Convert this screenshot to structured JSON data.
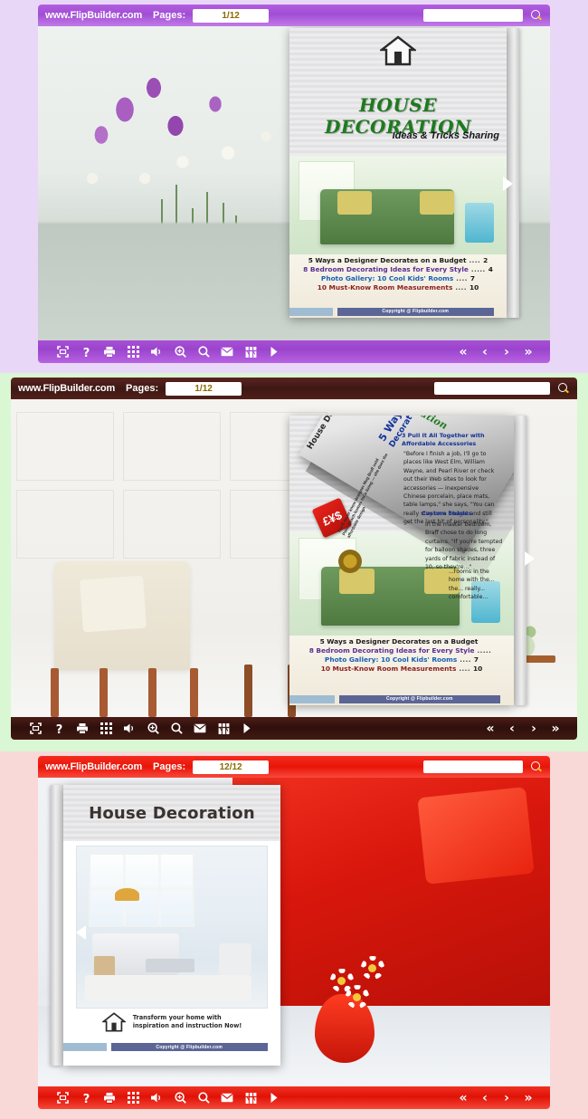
{
  "panels": [
    {
      "id": "panel-1",
      "theme_color": "#a84fd6",
      "background_color": "#e9d7f7",
      "topbar": {
        "brand": "www.FlipBuilder.com",
        "pages_label": "Pages:",
        "page_indicator": "1/12",
        "search_value": "",
        "search_placeholder": "",
        "search_icon": "search-icon"
      },
      "toolbar": {
        "buttons": [
          {
            "name": "fullscreen-icon",
            "label": "Fullscreen"
          },
          {
            "name": "help-icon",
            "label": "Help"
          },
          {
            "name": "print-icon",
            "label": "Print"
          },
          {
            "name": "thumbnails-icon",
            "label": "Thumbnails"
          },
          {
            "name": "sound-icon",
            "label": "Sound"
          },
          {
            "name": "zoom-in-icon",
            "label": "Zoom In"
          },
          {
            "name": "search-icon",
            "label": "Search"
          },
          {
            "name": "email-icon",
            "label": "Share by Email"
          },
          {
            "name": "bookmark-icon",
            "label": "Bookmark"
          },
          {
            "name": "auto-flip-icon",
            "label": "Auto Flip"
          }
        ],
        "nav": [
          {
            "name": "first-page-button",
            "glyph": "«"
          },
          {
            "name": "previous-page-button",
            "glyph": "‹"
          },
          {
            "name": "next-page-button",
            "glyph": "›"
          },
          {
            "name": "last-page-button",
            "glyph": "»"
          }
        ]
      },
      "flip_arrow": {
        "direction": "next",
        "glyph": "▶"
      },
      "book": {
        "cover_title": "HOUSE DECORATION",
        "cover_subtitle": "Ideas  & Tricks Sharing",
        "copyright": "Copyright @ Flipbuilder.com",
        "toc": [
          {
            "title": "5 Ways a Designer Decorates on a Budget",
            "dots": "....",
            "page": "2",
            "color": "#1b1b1b"
          },
          {
            "title": "8 Bedroom Decorating Ideas for Every Style",
            "dots": ".....",
            "page": "4",
            "color": "#5b2d91"
          },
          {
            "title": "Photo Gallery: 10 Cool Kids' Rooms",
            "dots": "....",
            "page": "7",
            "color": "#1a5fb4"
          },
          {
            "title": "10 Must-Know Room Measurements",
            "dots": "....",
            "page": "10",
            "color": "#8a1f1f"
          }
        ]
      }
    },
    {
      "id": "panel-2",
      "theme_color": "#3e1712",
      "background_color": "#d8f7d2",
      "topbar": {
        "brand": "www.FlipBuilder.com",
        "pages_label": "Pages:",
        "page_indicator": "1/12",
        "search_value": "",
        "search_placeholder": "",
        "search_icon": "search-icon"
      },
      "toolbar": {
        "buttons": [
          {
            "name": "fullscreen-icon",
            "label": "Fullscreen"
          },
          {
            "name": "help-icon",
            "label": "Help"
          },
          {
            "name": "print-icon",
            "label": "Print"
          },
          {
            "name": "thumbnails-icon",
            "label": "Thumbnails"
          },
          {
            "name": "sound-icon",
            "label": "Sound"
          },
          {
            "name": "zoom-in-icon",
            "label": "Zoom In"
          },
          {
            "name": "search-icon",
            "label": "Search"
          },
          {
            "name": "email-icon",
            "label": "Share by Email"
          },
          {
            "name": "bookmark-icon",
            "label": "Bookmark"
          },
          {
            "name": "auto-flip-icon",
            "label": "Auto Flip"
          }
        ],
        "nav": [
          {
            "name": "first-page-button",
            "glyph": "«"
          },
          {
            "name": "previous-page-button",
            "glyph": "‹"
          },
          {
            "name": "next-page-button",
            "glyph": "›"
          },
          {
            "name": "last-page-button",
            "glyph": "»"
          }
        ]
      },
      "flip_arrow": {
        "direction": "next",
        "glyph": "▶"
      },
      "book": {
        "cover_title": "House Decoration",
        "copyright": "Copyright @ Flipbuilder.com",
        "toc": [
          {
            "title": "5 Ways a Designer Decorates on a Budget",
            "dots": "",
            "page": "",
            "color": "#1b1b1b"
          },
          {
            "title": "8 Bedroom Decorating Ideas for Every Style",
            "dots": ".....",
            "page": "",
            "color": "#5b2d91"
          },
          {
            "title": "Photo Gallery: 10 Cool Kids' Rooms",
            "dots": "....",
            "page": "7",
            "color": "#1a5fb4"
          },
          {
            "title": "10 Must-Know Room Measurements",
            "dots": "....",
            "page": "10",
            "color": "#8a1f1f"
          }
        ],
        "turning_page": {
          "spine_title": "House Decoration",
          "section_label": "5 Ways",
          "section_label_2": "Decorat",
          "logo_text": "£¥$",
          "vertical_note": "You'll never know designer Meg Braff sold Palm Beach homes for a living — she does the affordable design",
          "heading": "3  Pull It All Together with Affordable Accessories",
          "body": "\"Before I finish a job, I'll go to places like West Elm, William Wayne, and Pearl River or check out their Web sites to look for accessories — inexpensive Chinese porcelain, place mats, table lamps,\" she says, \"You can really stay on a budget and still get the last bit of personality.\"",
          "heading_2": "Custom Shades",
          "body_2": "In the master bedroom, Braff chose to do long curtains. \"If you're tempted for balloon shades, three yards of fabric instead of 10, so they're...\"",
          "body_3": "...rooms in the home with the... the... really... comfortable..."
        }
      }
    },
    {
      "id": "panel-3",
      "theme_color": "#e01206",
      "background_color": "#f9d8d8",
      "topbar": {
        "brand": "www.FlipBuilder.com",
        "pages_label": "Pages:",
        "page_indicator": "12/12",
        "search_value": "",
        "search_placeholder": "",
        "search_icon": "search-icon"
      },
      "toolbar": {
        "buttons": [
          {
            "name": "fullscreen-icon",
            "label": "Fullscreen"
          },
          {
            "name": "help-icon",
            "label": "Help"
          },
          {
            "name": "print-icon",
            "label": "Print"
          },
          {
            "name": "thumbnails-icon",
            "label": "Thumbnails"
          },
          {
            "name": "sound-icon",
            "label": "Sound"
          },
          {
            "name": "zoom-in-icon",
            "label": "Zoom In"
          },
          {
            "name": "search-icon",
            "label": "Search"
          },
          {
            "name": "email-icon",
            "label": "Share by Email"
          },
          {
            "name": "bookmark-icon",
            "label": "Bookmark"
          },
          {
            "name": "auto-flip-icon",
            "label": "Auto Flip"
          }
        ],
        "nav": [
          {
            "name": "first-page-button",
            "glyph": "«"
          },
          {
            "name": "previous-page-button",
            "glyph": "‹"
          },
          {
            "name": "next-page-button",
            "glyph": "›"
          },
          {
            "name": "last-page-button",
            "glyph": "»"
          }
        ]
      },
      "flip_arrow": {
        "direction": "previous",
        "glyph": "◀"
      },
      "book": {
        "back_title": "House Decoration",
        "tagline_line1": "Transform your home with",
        "tagline_line2": "inspiration and instruction Now!",
        "copyright": "Copyright @ Flipbuilder.com",
        "house_icon": "house-icon"
      }
    }
  ]
}
